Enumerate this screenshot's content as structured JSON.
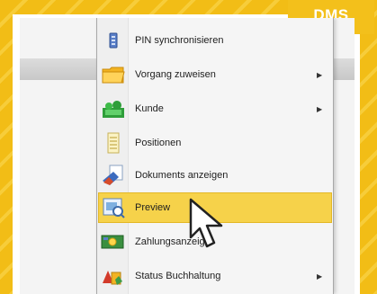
{
  "badge": {
    "text": "DMS"
  },
  "menu": {
    "items": [
      {
        "label": "PIN synchronisieren",
        "icon": "pin-sync-icon",
        "submenu": false
      },
      {
        "label": "Vorgang zuweisen",
        "icon": "folder-icon",
        "submenu": true
      },
      {
        "label": "Kunde",
        "icon": "customer-icon",
        "submenu": true
      },
      {
        "label": "Positionen",
        "icon": "list-icon",
        "submenu": false
      },
      {
        "label": "Dokuments anzeigen",
        "icon": "documents-icon",
        "submenu": false
      },
      {
        "label": "Preview",
        "icon": "preview-icon",
        "submenu": false,
        "highlighted": true
      },
      {
        "label": "Zahlungsanzeige",
        "icon": "payment-icon",
        "submenu": false
      },
      {
        "label": "Status Buchhaltung",
        "icon": "accounting-status-icon",
        "submenu": true
      }
    ]
  },
  "colors": {
    "accent": "#f3c01b",
    "highlight": "#f6d24a"
  }
}
